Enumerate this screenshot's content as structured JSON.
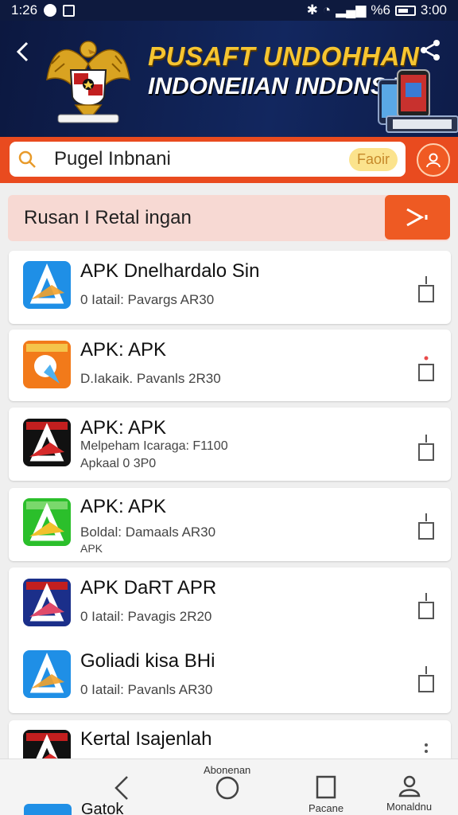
{
  "status_bar": {
    "time": "1:26",
    "right_time": "3:00",
    "signal_text": "%6"
  },
  "header": {
    "title_line1": "PUSAFT UNDOHHAN",
    "title_line2": "INDONEIIAN INDDNSAI"
  },
  "search": {
    "query": "Pugel Inbnani",
    "pill": "Faoir"
  },
  "retail": {
    "label": "Rusan I Retal ingan"
  },
  "apps": [
    {
      "title": "APK Dnelhardalo Sin",
      "sub": "0 Iatail: Pavargs  AR30",
      "sub2": "",
      "icon_color": "#1f8fe6",
      "icon_name": "apk-app-icon"
    },
    {
      "title": "APK: APK",
      "sub": "D.Iakaik. Pavanls  2R30",
      "sub2": "",
      "icon_color": "#f27a1a",
      "icon_name": "apk-app-icon"
    },
    {
      "title": "APK: APK",
      "sub": "Melpeham Icaraga: F1100",
      "sub2": "Apkaal 0 3P0",
      "icon_color": "#111111",
      "icon_name": "apk-app-icon"
    },
    {
      "title": "APK: APK",
      "sub": "Boldal: Damaals  AR30",
      "sub2": "APK",
      "icon_color": "#2bbf2b",
      "icon_name": "apk-app-icon"
    },
    {
      "title": "APK DaRT APR",
      "sub": "0 Iatail: Pavagis  2R20",
      "sub2": "",
      "icon_color": "#1b2f8a",
      "icon_name": "apk-app-icon"
    },
    {
      "title": "Goliadi kisa BHi",
      "sub": "0 Iatail: Pavanls  AR30",
      "sub2": "",
      "icon_color": "#1f8fe6",
      "icon_name": "apk-app-icon"
    },
    {
      "title": "Kertal Isajenlah",
      "sub": "",
      "sub2": "",
      "icon_color": "#111111",
      "icon_name": "apk-app-icon"
    }
  ],
  "bottom_partial": {
    "title": "Gatok"
  },
  "nav": {
    "center_label": "Abonenan",
    "pages_label": "Pacane",
    "profile_label": "Monaldnu"
  },
  "colors": {
    "header_bg": "#0e1a3e",
    "accent_orange": "#e94b1f",
    "title_gold": "#f6c531"
  }
}
